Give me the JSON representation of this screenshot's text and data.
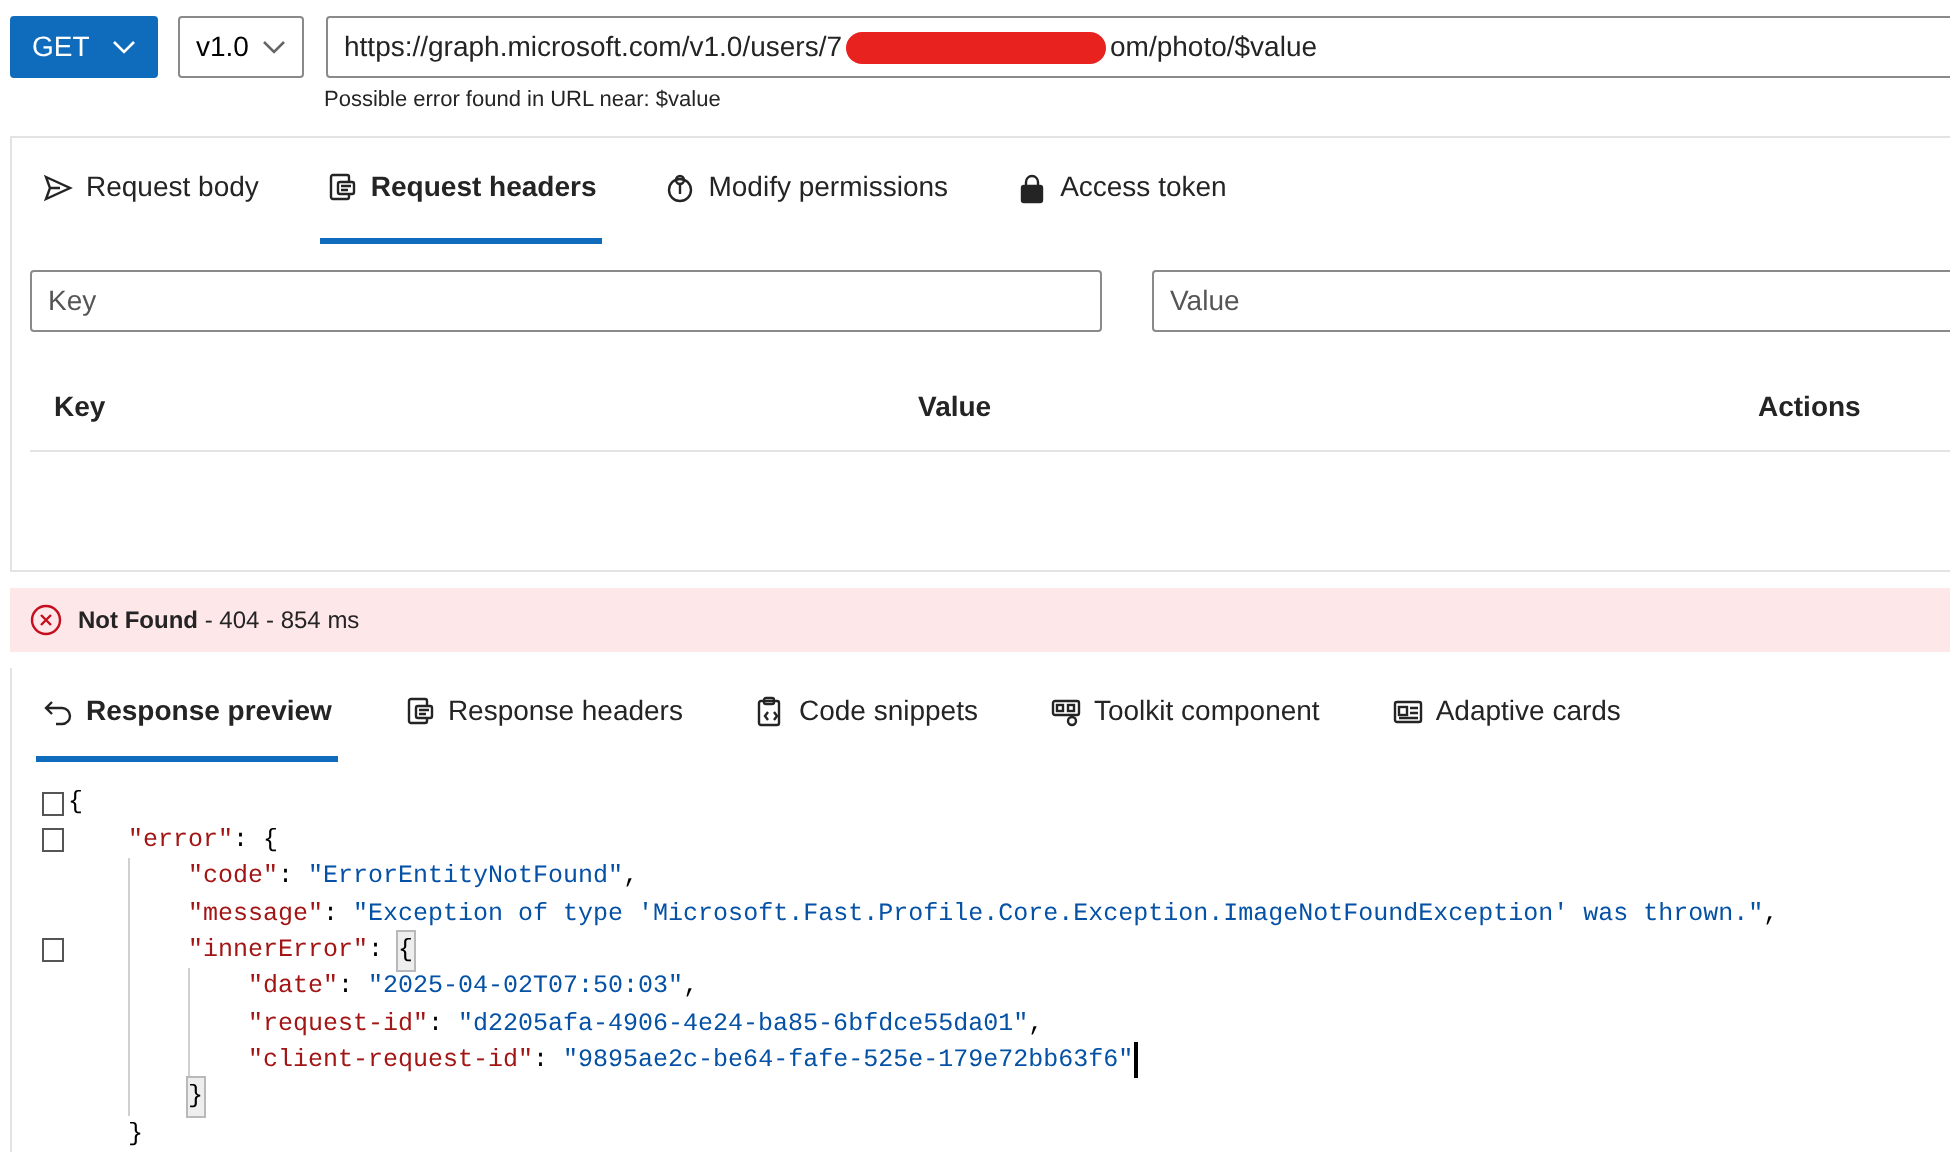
{
  "method": {
    "label": "GET"
  },
  "version": {
    "label": "v1.0"
  },
  "url": {
    "before": "https://graph.microsoft.com/v1.0/users/7",
    "after": "om/photo/$value",
    "redacted": true
  },
  "url_hint": "Possible error found in URL near: $value",
  "request_tabs": [
    {
      "label": "Request body",
      "selected": false
    },
    {
      "label": "Request headers",
      "selected": true
    },
    {
      "label": "Modify permissions",
      "selected": false
    },
    {
      "label": "Access token",
      "selected": false
    }
  ],
  "header_inputs": {
    "key_placeholder": "Key",
    "value_placeholder": "Value"
  },
  "headers_table": {
    "columns": [
      "Key",
      "Value",
      "Actions"
    ]
  },
  "status": {
    "kind": "error",
    "title": "Not Found",
    "detail": "- 404 - 854 ms"
  },
  "response_tabs": [
    {
      "label": "Response preview",
      "selected": true
    },
    {
      "label": "Response headers",
      "selected": false
    },
    {
      "label": "Code snippets",
      "selected": false
    },
    {
      "label": "Toolkit component",
      "selected": false
    },
    {
      "label": "Adaptive cards",
      "selected": false
    }
  ],
  "code": [
    {
      "foldable": true,
      "parts": [
        {
          "kind": "punct",
          "text": "{"
        }
      ],
      "children": [
        {
          "foldable": true,
          "parts": [
            {
              "kind": "key",
              "text": "\"error\""
            },
            {
              "kind": "punct",
              "text": ": {"
            }
          ],
          "children": [
            {
              "parts": [
                {
                  "kind": "key",
                  "text": "\"code\""
                },
                {
                  "kind": "punct",
                  "text": ": "
                },
                {
                  "kind": "string",
                  "text": "\"ErrorEntityNotFound\""
                },
                {
                  "kind": "punct",
                  "text": ","
                }
              ]
            },
            {
              "parts": [
                {
                  "kind": "key",
                  "text": "\"message\""
                },
                {
                  "kind": "punct",
                  "text": ": "
                },
                {
                  "kind": "string",
                  "text": "\"Exception of type 'Microsoft.Fast.Profile.Core.Exception.ImageNotFoundException' was thrown.\""
                },
                {
                  "kind": "punct",
                  "text": ","
                }
              ]
            },
            {
              "foldable": true,
              "parts": [
                {
                  "kind": "key",
                  "text": "\"innerError\""
                },
                {
                  "kind": "punct",
                  "text": ": "
                },
                {
                  "kind": "match",
                  "text": "{"
                }
              ],
              "children": [
                {
                  "parts": [
                    {
                      "kind": "key",
                      "text": "\"date\""
                    },
                    {
                      "kind": "punct",
                      "text": ": "
                    },
                    {
                      "kind": "string",
                      "text": "\"2025-04-02T07:50:03\""
                    },
                    {
                      "kind": "punct",
                      "text": ","
                    }
                  ]
                },
                {
                  "parts": [
                    {
                      "kind": "key",
                      "text": "\"request-id\""
                    },
                    {
                      "kind": "punct",
                      "text": ": "
                    },
                    {
                      "kind": "string",
                      "text": "\"d2205afa-4906-4e24-ba85-6bfdce55da01\""
                    },
                    {
                      "kind": "punct",
                      "text": ","
                    }
                  ]
                },
                {
                  "cursor": true,
                  "parts": [
                    {
                      "kind": "key",
                      "text": "\"client-request-id\""
                    },
                    {
                      "kind": "punct",
                      "text": ": "
                    },
                    {
                      "kind": "string",
                      "text": "\"9895ae2c-be64-fafe-525e-179e72bb63f6\""
                    }
                  ]
                }
              ],
              "close": {
                "parts": [
                  {
                    "kind": "match",
                    "text": "}"
                  }
                ]
              }
            }
          ],
          "close": {
            "parts": [
              {
                "kind": "punct",
                "text": "}"
              }
            ]
          }
        }
      ]
    }
  ]
}
